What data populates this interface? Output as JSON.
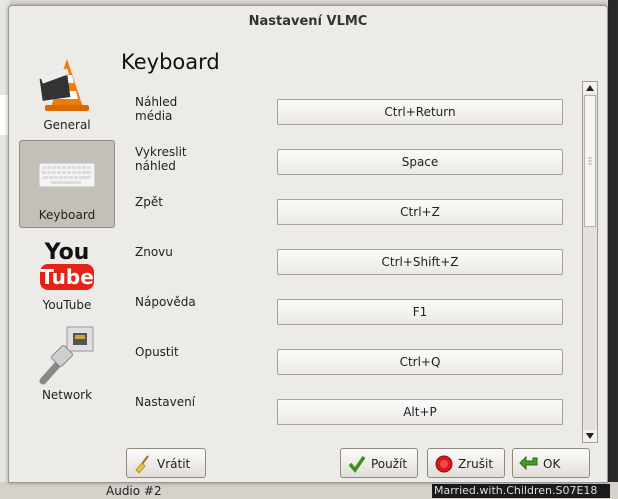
{
  "window": {
    "title": "Nastavení VLMC"
  },
  "sidebar": {
    "items": [
      {
        "label": "General",
        "icon": "vlc-cone-icon"
      },
      {
        "label": "Keyboard",
        "icon": "keyboard-icon"
      },
      {
        "label": "YouTube",
        "icon": "youtube-icon"
      },
      {
        "label": "Network",
        "icon": "network-cable-icon"
      }
    ]
  },
  "panel": {
    "title": "Keyboard"
  },
  "shortcuts": [
    {
      "label": "Náhled média",
      "key": "Ctrl+Return"
    },
    {
      "label": "Vykreslit náhled",
      "key": "Space"
    },
    {
      "label": "Zpět",
      "key": "Ctrl+Z"
    },
    {
      "label": "Znovu",
      "key": "Ctrl+Shift+Z"
    },
    {
      "label": "Nápověda",
      "key": "F1"
    },
    {
      "label": "Opustit",
      "key": "Ctrl+Q"
    },
    {
      "label": "Nastavení",
      "key": "Alt+P"
    }
  ],
  "buttons": {
    "revert": "Vrátit",
    "apply": "Použít",
    "cancel": "Zrušit",
    "ok": "OK"
  },
  "background": {
    "audio_track": "Audio #2",
    "film_title": "Married.with.Children.S07E18"
  },
  "colors": {
    "youtube_red": "#e62117",
    "vlc_orange": "#f07d0a"
  }
}
